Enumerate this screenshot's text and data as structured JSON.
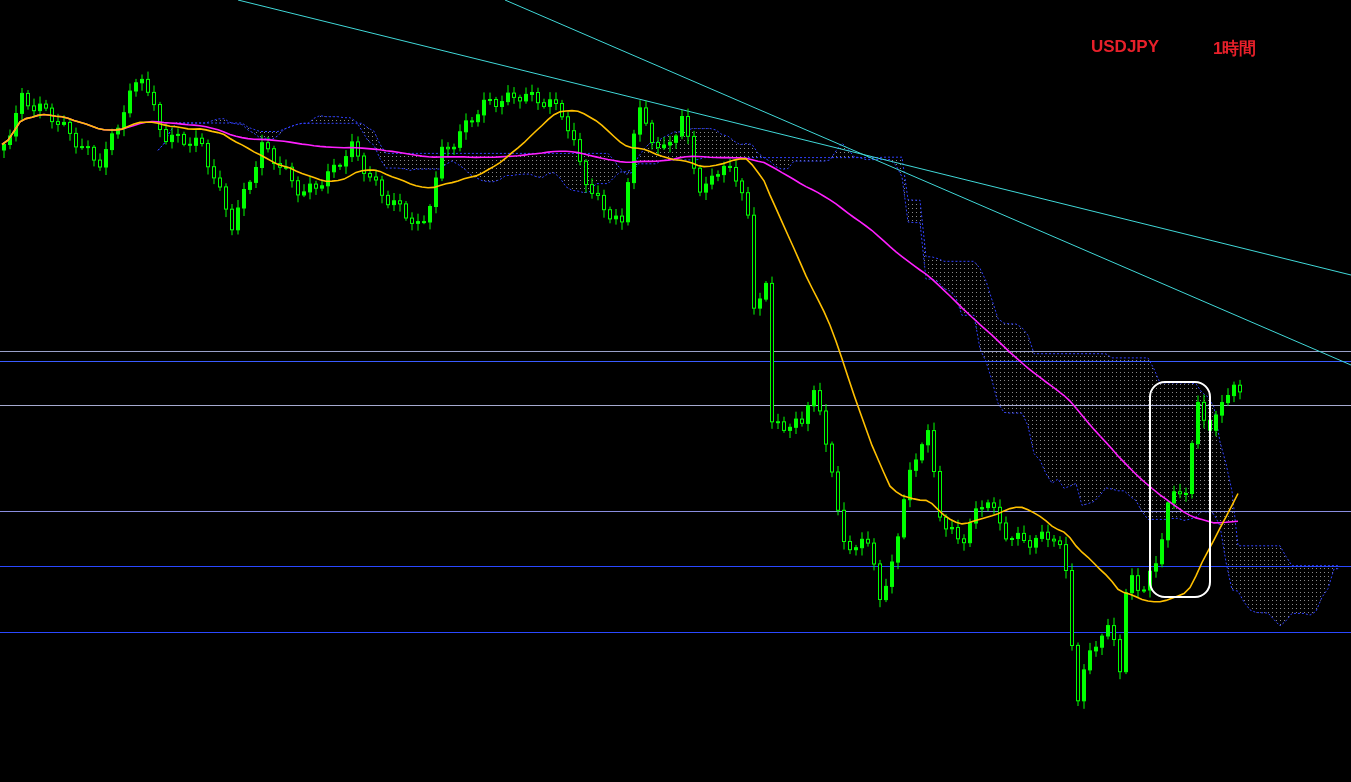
{
  "chart": {
    "symbol": "USDJPY",
    "timeframe": "1時間"
  }
}
